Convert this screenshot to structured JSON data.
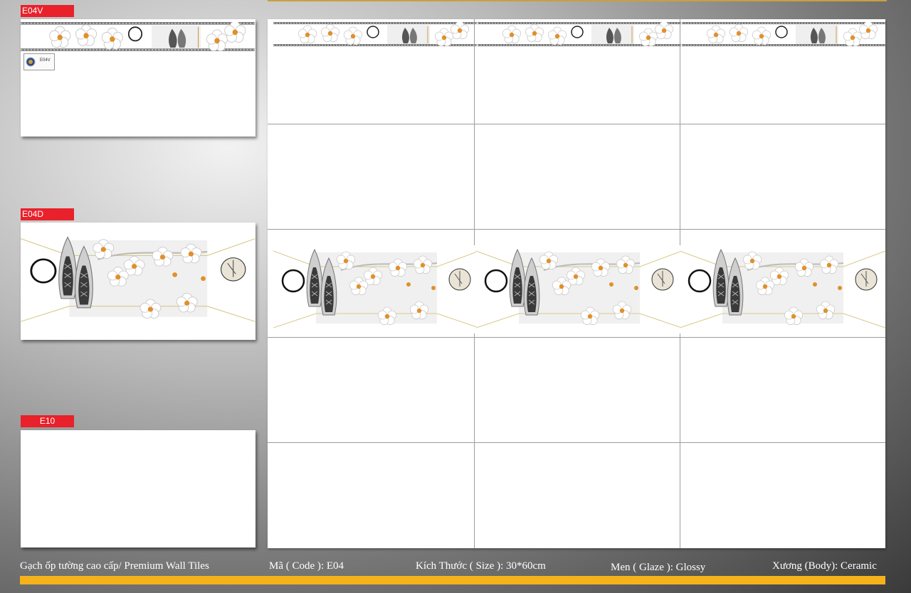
{
  "labels": {
    "e04v": "E04V",
    "e04d": "E04D",
    "e10": "E10"
  },
  "thumb_e04v": {
    "badge_code": "E04V"
  },
  "info": {
    "product": "Gạch ốp tường cao cấp/ Premium Wall Tiles",
    "code": "Mã ( Code ): E04",
    "size": "Kích Thước ( Size ): 30*60cm",
    "glaze": "Men ( Glaze ): Glossy",
    "body": "Xương (Body): Ceramic"
  },
  "colors": {
    "label_red": "#e8212b",
    "accent_bar": "#f6b21a",
    "flower_center": "#e0902a",
    "gold_line": "#c8a040"
  }
}
